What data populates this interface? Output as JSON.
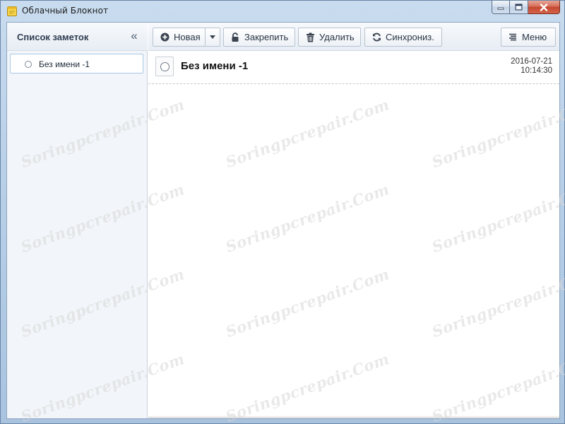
{
  "window": {
    "title": "Облачный Блокнот",
    "controls": {
      "minimize": "minimize-icon",
      "maximize": "maximize-icon",
      "close": "close-icon"
    }
  },
  "sidebar": {
    "title": "Список заметок",
    "collapse_label": "«",
    "notes": [
      {
        "label": "Без имени -1"
      }
    ]
  },
  "toolbar": {
    "new_label": "Новая",
    "pin_label": "Закрепить",
    "delete_label": "Удалить",
    "sync_label": "Синхрониз.",
    "menu_label": "Меню"
  },
  "note": {
    "title": "Без имени -1",
    "date": "2016-07-21",
    "time": "10:14:30"
  },
  "watermark": {
    "text": "Soringpcrepair.Com"
  },
  "colors": {
    "accent": "#a7c7e6",
    "close_button": "#c4472f"
  }
}
